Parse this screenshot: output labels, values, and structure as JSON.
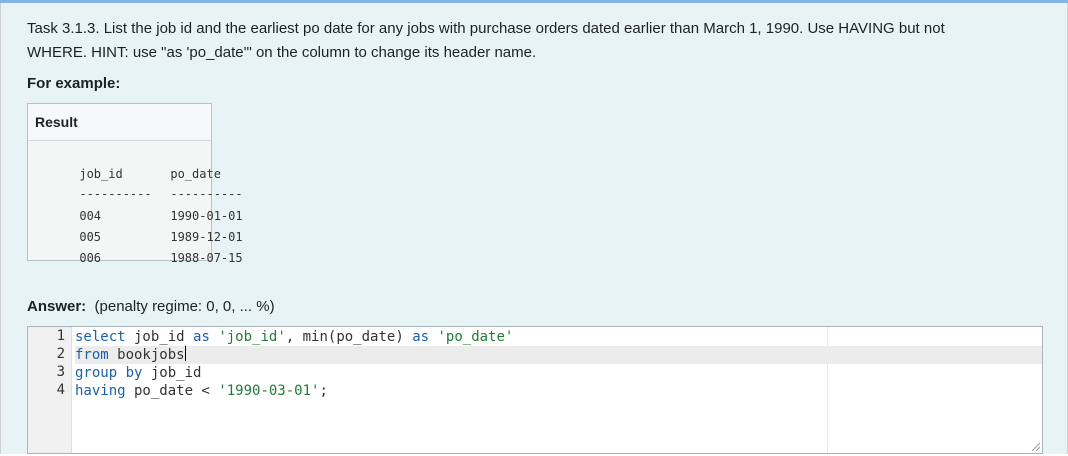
{
  "task": {
    "line1": "Task 3.1.3. List the job id and the earliest po date for any jobs with purchase orders dated earlier than March 1, 1990. Use HAVING but not",
    "line2": "WHERE. HINT: use \"as 'po_date'\" on the column to change its header name."
  },
  "example": {
    "label": "For example:",
    "result_header": "Result",
    "columns": [
      "job_id",
      "po_date"
    ],
    "separators": [
      "----------",
      "----------"
    ],
    "rows": [
      [
        "004",
        "1990-01-01"
      ],
      [
        "005",
        "1989-12-01"
      ],
      [
        "006",
        "1988-07-15"
      ]
    ]
  },
  "answer": {
    "label": "Answer:",
    "penalty": "(penalty regime: 0, 0, ... %)"
  },
  "editor": {
    "line_numbers": [
      "1",
      "2",
      "3",
      "4"
    ],
    "lines": {
      "l1": {
        "kw1": "select",
        "t1": " job_id ",
        "kw2": "as",
        "t2": " ",
        "s1": "'job_id'",
        "t3": ", min(po_date) ",
        "kw3": "as",
        "t4": " ",
        "s2": "'po_date'"
      },
      "l2": {
        "kw1": "from",
        "t1": " bookjobs"
      },
      "l3": {
        "kw1": "group",
        "t1": " ",
        "kw2": "by",
        "t2": " job_id"
      },
      "l4": {
        "kw1": "having",
        "t1": " po_date < ",
        "s1": "'1990-03-01'",
        "t2": ";"
      }
    }
  },
  "colors": {
    "accent_bar": "#82b4e6",
    "panel_bg": "#e7f3f5",
    "keyword": "#1a5fb4",
    "string": "#1e7d35"
  }
}
